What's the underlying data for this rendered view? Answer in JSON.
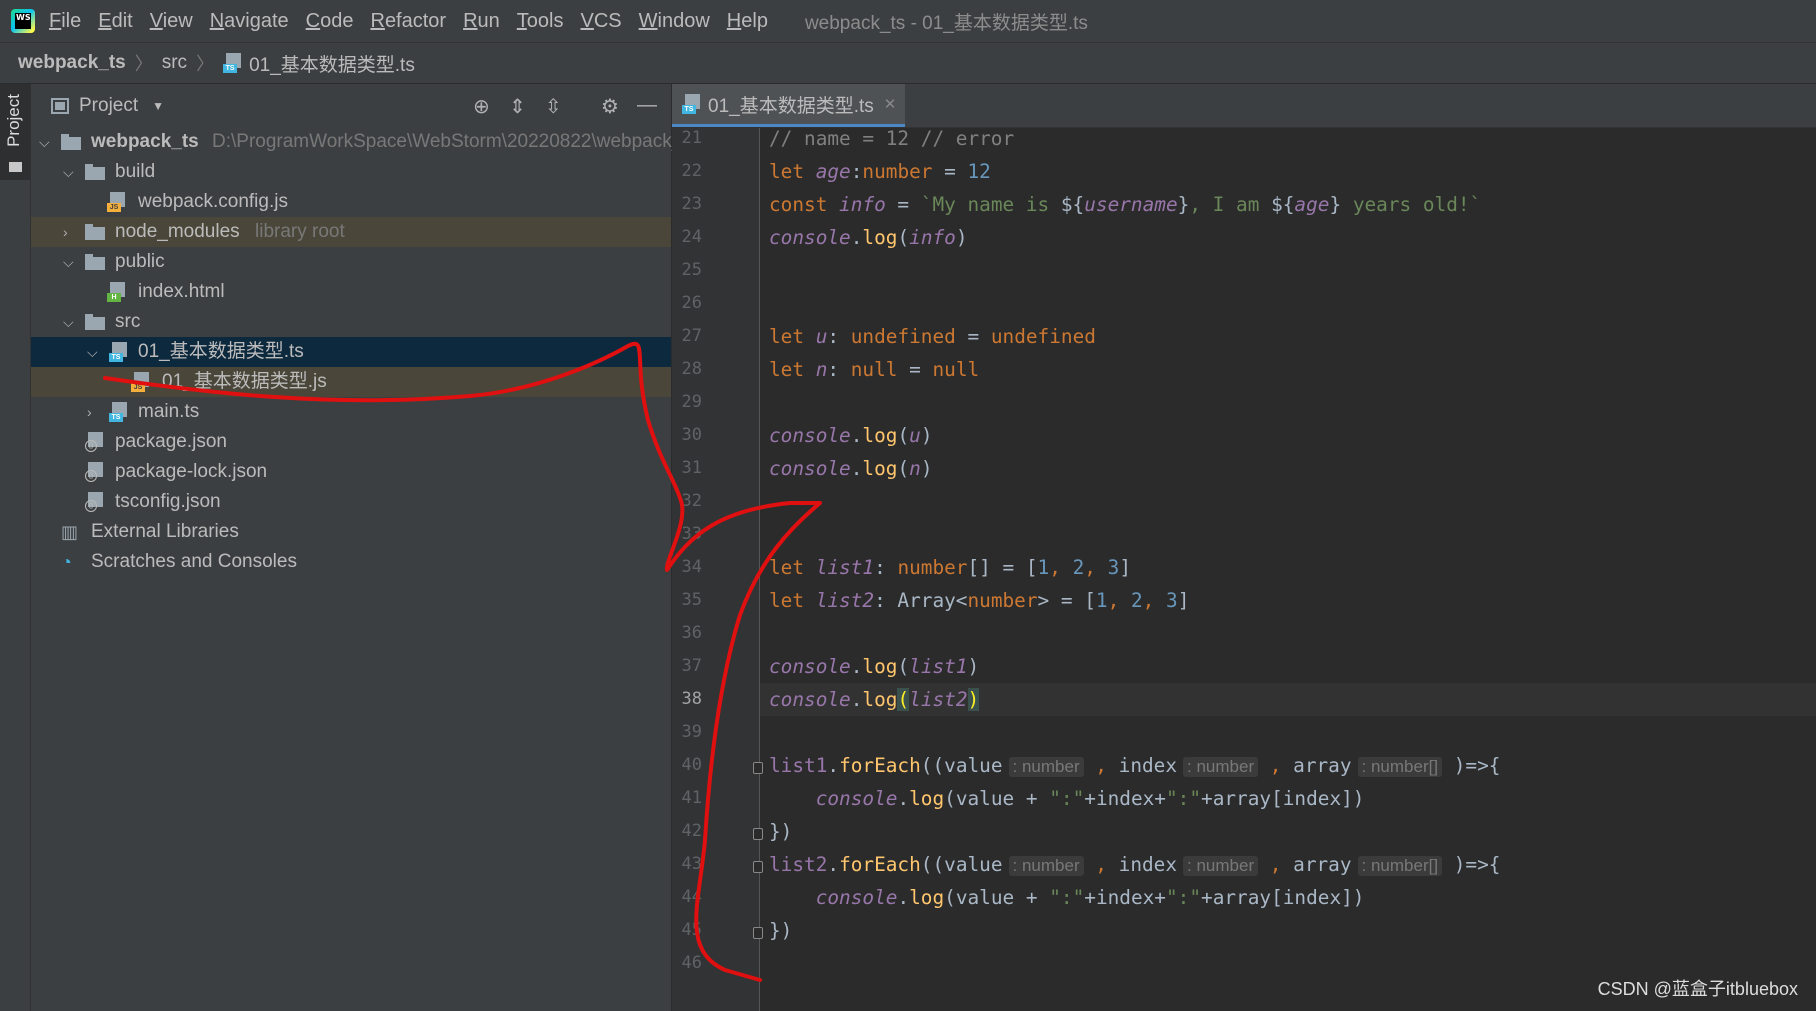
{
  "menubar": {
    "items": [
      "File",
      "Edit",
      "View",
      "Navigate",
      "Code",
      "Refactor",
      "Run",
      "Tools",
      "VCS",
      "Window",
      "Help"
    ],
    "window_title": "webpack_ts - 01_基本数据类型.ts",
    "logo_text": "WS"
  },
  "navbar": {
    "project": "webpack_ts",
    "folder": "src",
    "file": "01_基本数据类型.ts"
  },
  "left_strip": {
    "label": "Project"
  },
  "project_panel": {
    "title": "Project",
    "tree": [
      {
        "name": "webpack_ts",
        "extra": "D:\\ProgramWorkSpace\\WebStorm\\20220822\\webpack_ts"
      },
      {
        "name": "build"
      },
      {
        "name": "webpack.config.js"
      },
      {
        "name": "node_modules",
        "extra": "library root"
      },
      {
        "name": "public"
      },
      {
        "name": "index.html"
      },
      {
        "name": "src"
      },
      {
        "name": "01_基本数据类型.ts"
      },
      {
        "name": "01_基本数据类型.js"
      },
      {
        "name": "main.ts"
      },
      {
        "name": "package.json"
      },
      {
        "name": "package-lock.json"
      },
      {
        "name": "tsconfig.json"
      },
      {
        "name": "External Libraries"
      },
      {
        "name": "Scratches and Consoles"
      }
    ]
  },
  "editor": {
    "tab_name": "01_基本数据类型.ts",
    "line_numbers": [
      "21",
      "22",
      "23",
      "24",
      "25",
      "26",
      "27",
      "28",
      "29",
      "30",
      "31",
      "32",
      "33",
      "34",
      "35",
      "36",
      "37",
      "38",
      "39",
      "40",
      "41",
      "42",
      "43",
      "44",
      "45",
      "46"
    ],
    "current_line": "38",
    "hints": {
      "number": ": number",
      "number_array": ": number[]"
    }
  },
  "watermark": "CSDN @蓝盒子itbluebox",
  "colors": {
    "keyword": "#cc7832",
    "number": "#6897bb",
    "string": "#6a8759",
    "comment": "#808080",
    "variable": "#9876aa",
    "function": "#ffc66d",
    "annotation_stroke": "#e01010"
  }
}
